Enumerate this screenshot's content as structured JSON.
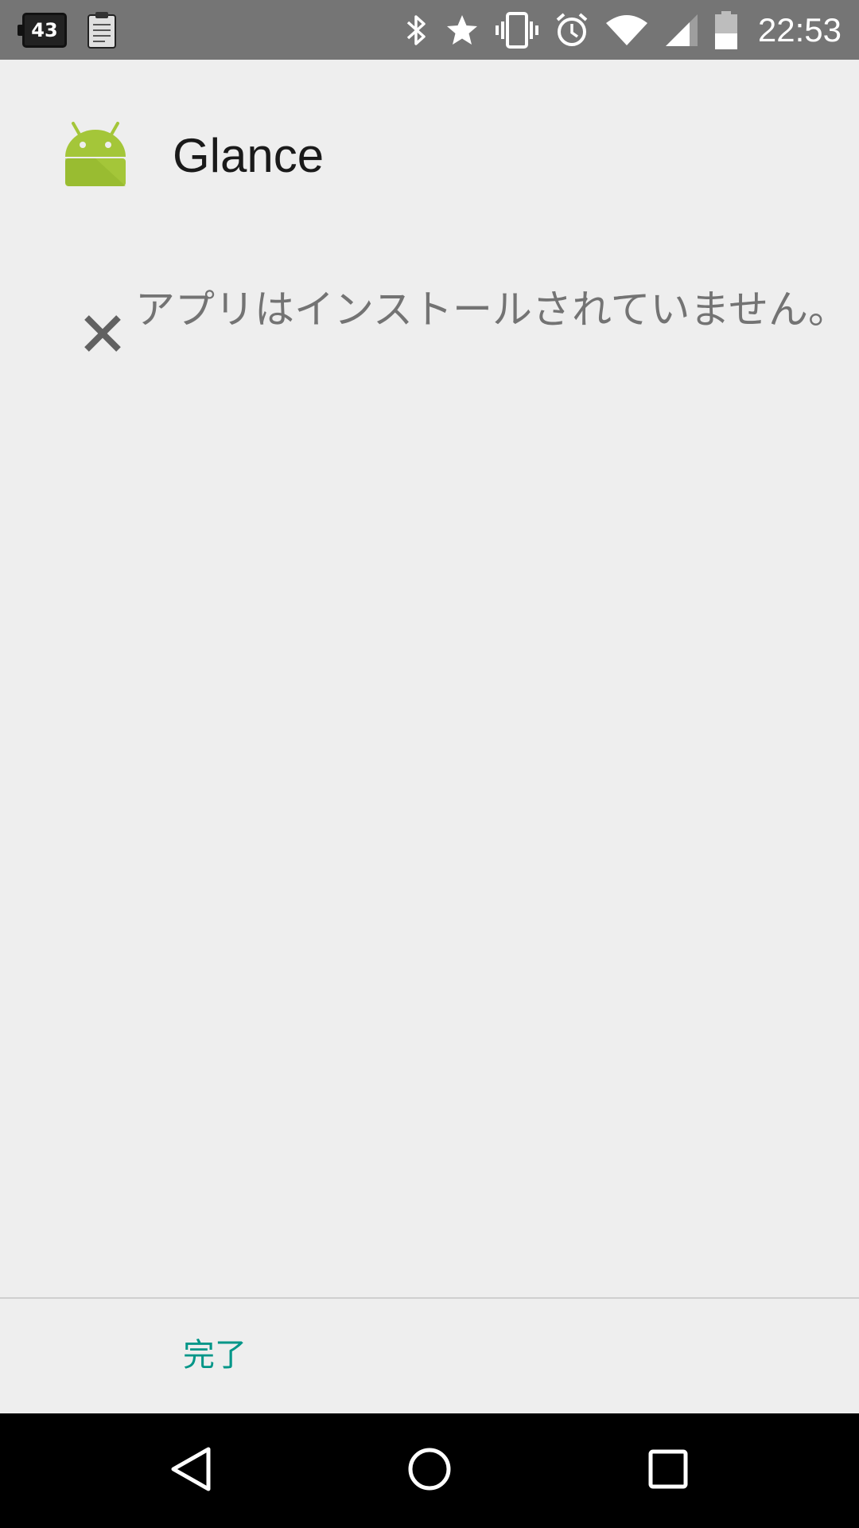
{
  "status_bar": {
    "notification_badge": "43",
    "time": "22:53",
    "icons": [
      "notification-count-icon",
      "clipboard-icon",
      "bluetooth-icon",
      "star-icon",
      "vibrate-icon",
      "alarm-icon",
      "wifi-icon",
      "cell-signal-icon",
      "battery-icon"
    ]
  },
  "app": {
    "name": "Glance",
    "icon": "android-robot-icon"
  },
  "result": {
    "icon": "close-icon",
    "message": "アプリはインストールされていません。"
  },
  "footer": {
    "done_label": "完了"
  },
  "nav_bar": {
    "icons": [
      "back-icon",
      "home-icon",
      "recents-icon"
    ]
  },
  "colors": {
    "status_bar": "#757575",
    "background": "#eeeeee",
    "accent": "#009688",
    "android_green": "#a4c639",
    "nav_bar": "#000000"
  }
}
